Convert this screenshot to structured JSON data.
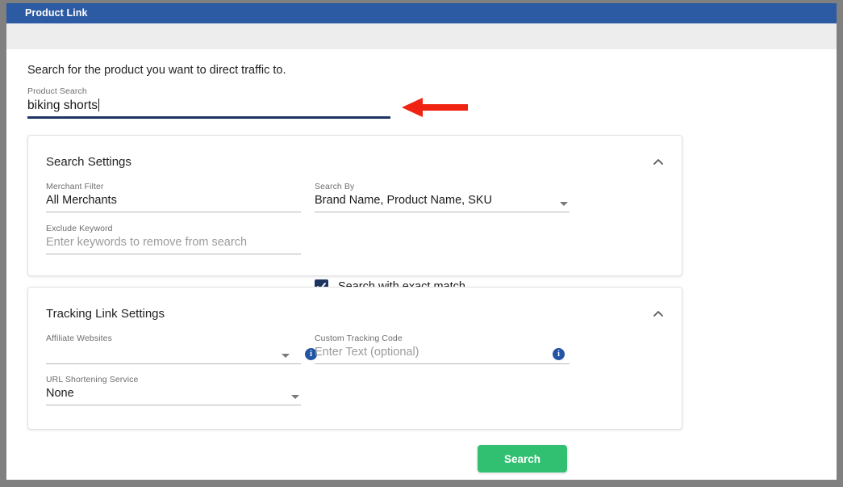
{
  "window": {
    "title": "Product Link"
  },
  "main": {
    "intro": "Search for the product you want to direct traffic to.",
    "product_search": {
      "label": "Product Search",
      "value": "biking shorts",
      "placeholder": ""
    },
    "annotation": {
      "name": "red-left-arrow",
      "color": "#f02211"
    }
  },
  "search_settings": {
    "title": "Search Settings",
    "collapse_icon": "chevron-up-icon",
    "merchant_filter": {
      "label": "Merchant Filter",
      "value": "All Merchants"
    },
    "search_by": {
      "label": "Search By",
      "value": "Brand Name, Product Name, SKU"
    },
    "exclude_keyword": {
      "label": "Exclude Keyword",
      "value": "",
      "placeholder": "Enter keywords to remove from search"
    },
    "exact_match": {
      "label": "Search with exact match",
      "checked": true
    }
  },
  "tracking_settings": {
    "title": "Tracking Link Settings",
    "collapse_icon": "chevron-up-icon",
    "affiliate_websites": {
      "label": "Affiliate Websites",
      "value": "",
      "info_icon": "info-icon"
    },
    "custom_tracking_code": {
      "label": "Custom Tracking Code",
      "value": "",
      "placeholder": "Enter Text (optional)",
      "info_icon": "info-icon"
    },
    "url_shortening": {
      "label": "URL Shortening Service",
      "value": "None"
    }
  },
  "actions": {
    "search_label": "Search"
  },
  "colors": {
    "titlebar": "#2d5ba3",
    "accent_navy": "#1d3461",
    "button_green": "#31c072",
    "info_blue": "#2255a4",
    "arrow_red": "#f02211"
  }
}
